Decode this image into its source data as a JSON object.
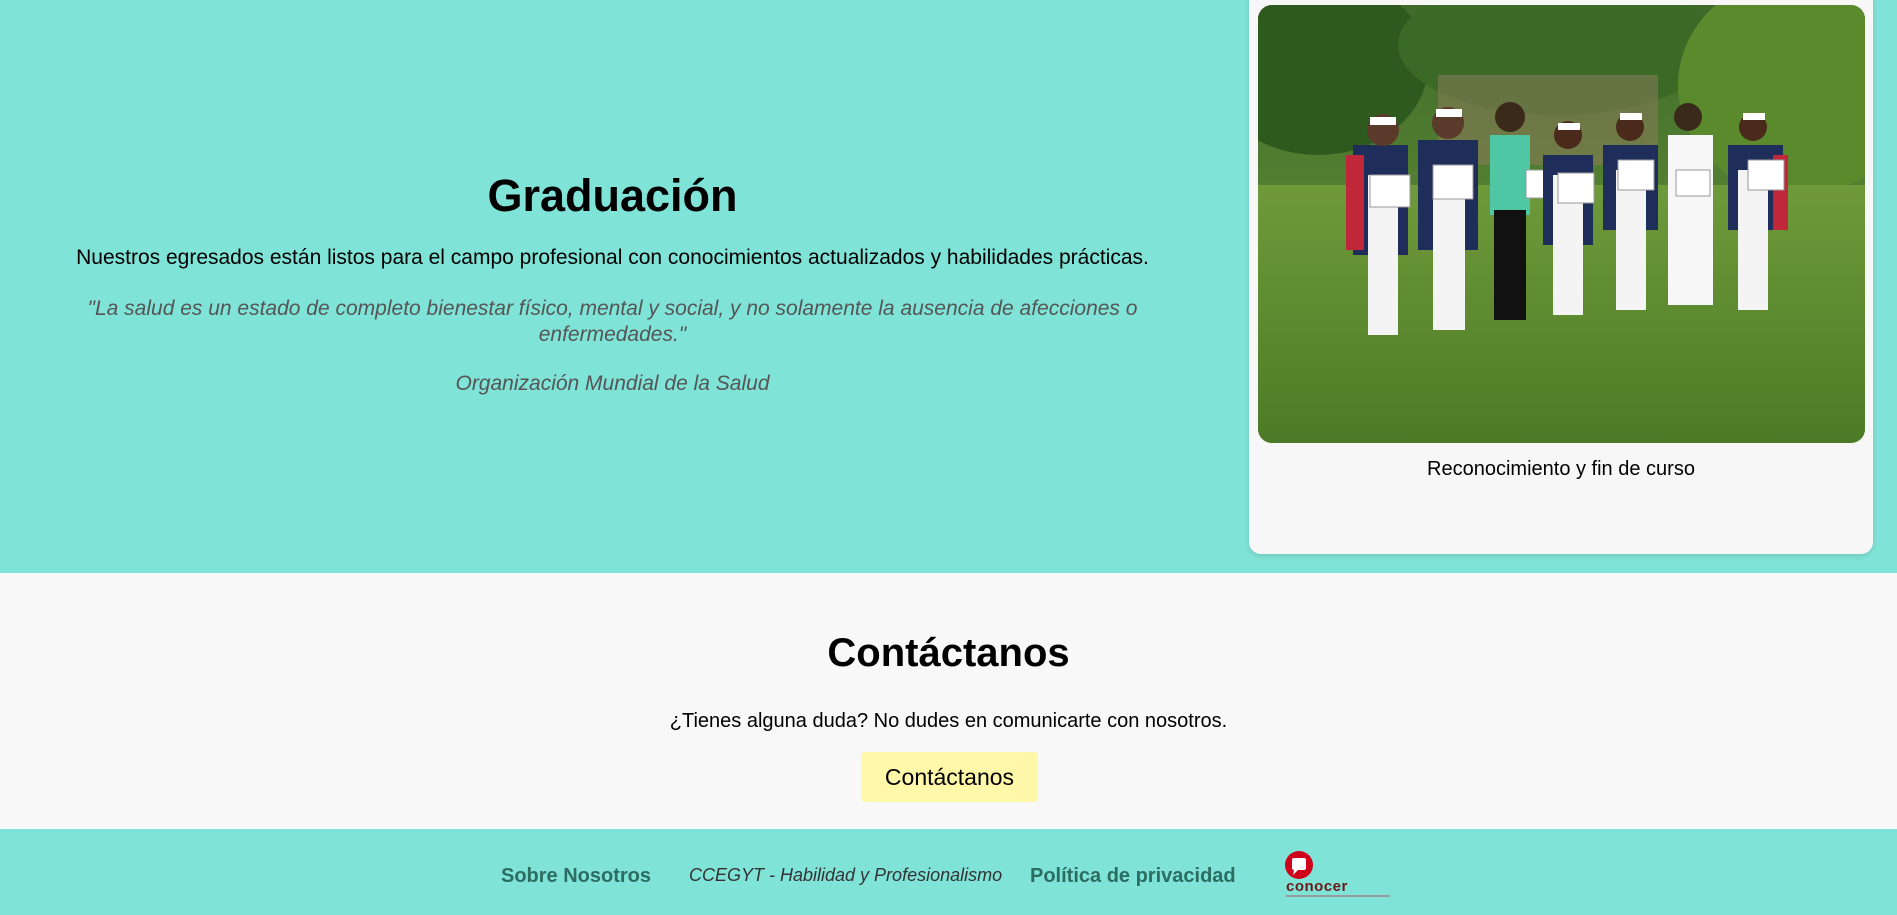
{
  "graduation": {
    "title": "Graduación",
    "description": "Nuestros egresados están listos para el campo profesional con conocimientos actualizados y habilidades prácticas.",
    "quote": "\"La salud es un estado de completo bienestar físico, mental y social, y no solamente la ausencia de afecciones o enfermedades.\"",
    "author": "Organización Mundial de la Salud"
  },
  "card": {
    "caption": "Reconocimiento y fin de curso",
    "image_icon": "graduation-photo"
  },
  "contact": {
    "title": "Contáctanos",
    "text": "¿Tienes alguna duda? No dudes en comunicarte con nosotros.",
    "button_label": "Contáctanos"
  },
  "footer": {
    "about_label": "Sobre Nosotros",
    "tagline": "CCEGYT - Habilidad y Profesionalismo",
    "privacy_label": "Política de privacidad",
    "logo_text": "conocer"
  },
  "colors": {
    "teal": "#80e3d7",
    "footer_link": "#2c6d62",
    "button": "#fff8a8",
    "logo_red": "#d0021b"
  }
}
